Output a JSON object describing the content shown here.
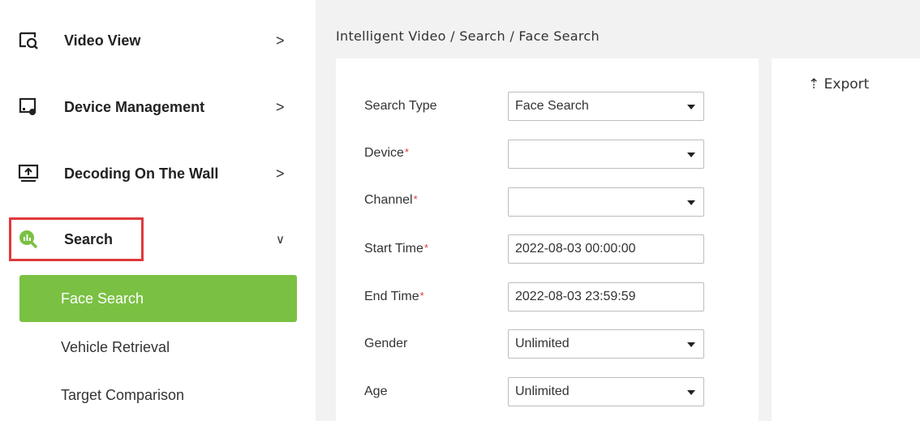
{
  "sidebar": {
    "items": [
      {
        "label": "Video View",
        "chevron": ">"
      },
      {
        "label": "Device Management",
        "chevron": ">"
      },
      {
        "label": "Decoding On The Wall",
        "chevron": ">"
      },
      {
        "label": "Search",
        "chevron": "∨"
      }
    ],
    "subitems": [
      {
        "label": "Face Search",
        "active": true
      },
      {
        "label": "Vehicle Retrieval",
        "active": false
      },
      {
        "label": "Target Comparison",
        "active": false
      }
    ]
  },
  "breadcrumb": "Intelligent Video / Search / Face Search",
  "toolbar": {
    "export_label": "Export",
    "export_icon": "⇡"
  },
  "form": {
    "required_mark": "*",
    "search_type": {
      "label": "Search Type",
      "value": "Face Search"
    },
    "device": {
      "label": "Device",
      "value": ""
    },
    "channel": {
      "label": "Channel",
      "value": ""
    },
    "start_time": {
      "label": "Start Time",
      "value": "2022-08-03 00:00:00"
    },
    "end_time": {
      "label": "End Time",
      "value": "2022-08-03 23:59:59"
    },
    "gender": {
      "label": "Gender",
      "value": "Unlimited"
    },
    "age": {
      "label": "Age",
      "value": "Unlimited"
    }
  },
  "colors": {
    "accent": "#7ac143",
    "highlight": "#e0393b",
    "required": "#e0393b"
  }
}
